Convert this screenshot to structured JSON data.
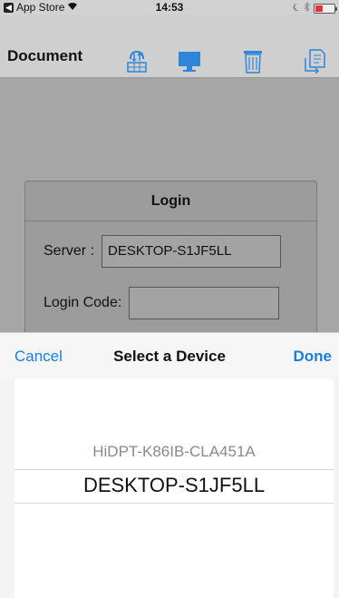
{
  "status_bar": {
    "back_app": "App Store",
    "time": "14:53"
  },
  "nav": {
    "title": "Document",
    "icons": [
      "transfer-icon",
      "monitor-icon",
      "trash-icon",
      "export-document-icon"
    ]
  },
  "login": {
    "title": "Login",
    "server_label": "Server :",
    "server_value": "DESKTOP-S1JF5LL",
    "code_label": "Login Code:",
    "code_value": ""
  },
  "picker": {
    "cancel_label": "Cancel",
    "title": "Select a Device",
    "done_label": "Done",
    "options": [
      "HiDPT-K86IB-CLA451A",
      "DESKTOP-S1JF5LL"
    ],
    "selected": "DESKTOP-S1JF5LL"
  },
  "colors": {
    "accent": "#1c7cd6",
    "nav_icon_blue": "#2f86d9",
    "battery_low": "#e0353b"
  }
}
